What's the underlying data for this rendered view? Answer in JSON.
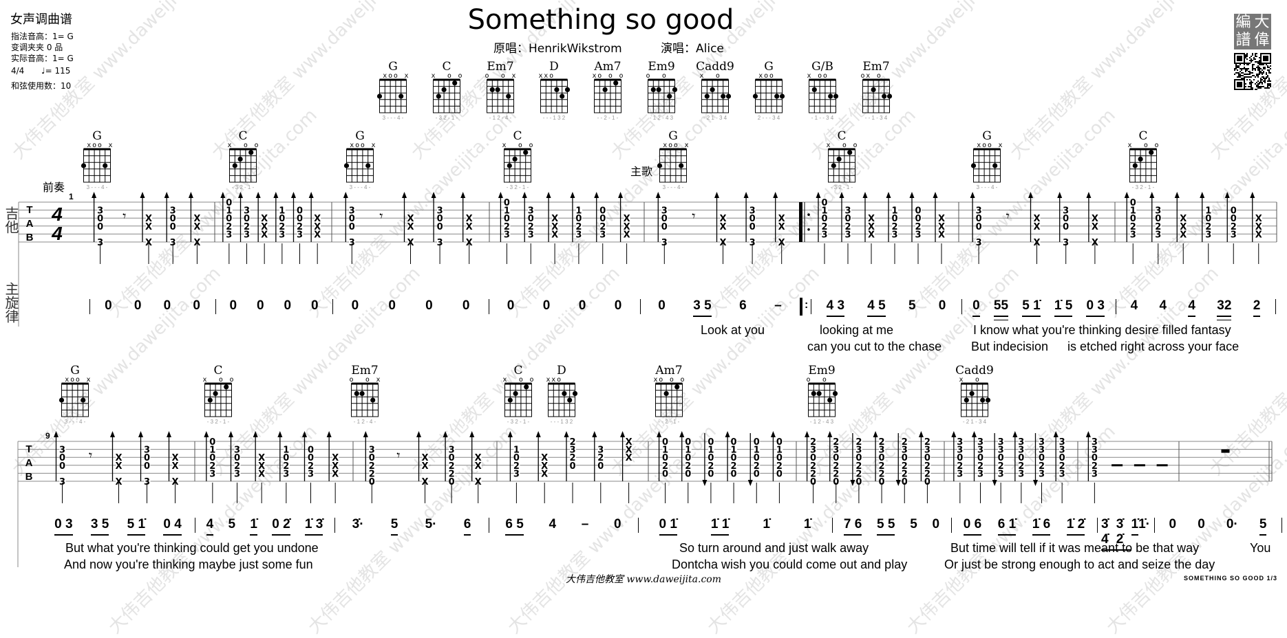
{
  "watermark": {
    "cn": "大伟吉他教室",
    "url": "www.daweijita.com"
  },
  "header": {
    "type": "女声调曲谱",
    "fingering_key": "指法音高：1= G",
    "capo": "变调夹夹  0 品",
    "actual_key": "实际音高：1= G",
    "time_signature": "4/4",
    "tempo": "♩= 115",
    "chord_count": "和弦使用数：10"
  },
  "title": "Something so good",
  "original_singer": "原唱：HenrikWikstrom",
  "performer": "演唱：Alice",
  "logo": [
    "編",
    "大",
    "譜",
    "偉"
  ],
  "chord_library": {
    "G": {
      "name": "G",
      "markers": " xoo x",
      "dots": [
        [
          6,
          3
        ],
        [
          2,
          3
        ]
      ],
      "fingering": "3 - - - 4 -"
    },
    "C": {
      "name": "C",
      "markers": "x  o o",
      "dots": [
        [
          5,
          3
        ],
        [
          4,
          2
        ],
        [
          2,
          1
        ]
      ],
      "fingering": "- 3 2 - 1 -"
    },
    "Em7": {
      "name": "Em7",
      "markers": "o  o x",
      "dots": [
        [
          5,
          2
        ],
        [
          4,
          2
        ],
        [
          2,
          3
        ]
      ],
      "fingering": "- 1 2 - 4 -"
    },
    "D": {
      "name": "D",
      "markers": "xxo   ",
      "dots": [
        [
          3,
          2
        ],
        [
          2,
          3
        ],
        [
          1,
          2
        ]
      ],
      "fingering": "- - - 1 3 2"
    },
    "Am7": {
      "name": "Am7",
      "markers": "xo o o",
      "dots": [
        [
          4,
          2
        ],
        [
          2,
          1
        ]
      ],
      "fingering": "- - 2 - 1 -"
    },
    "Em9": {
      "name": "Em9",
      "markers": "o  o  ",
      "dots": [
        [
          5,
          2
        ],
        [
          4,
          2
        ],
        [
          2,
          3
        ],
        [
          1,
          2
        ]
      ],
      "fingering": "- 1 2 - 4 3"
    },
    "Cadd9": {
      "name": "Cadd9",
      "markers": "x  o  ",
      "dots": [
        [
          5,
          3
        ],
        [
          4,
          2
        ],
        [
          2,
          3
        ],
        [
          1,
          3
        ]
      ],
      "fingering": "- 2 1 - 3 4"
    },
    "G2": {
      "name": "G",
      "markers": " xoo  ",
      "dots": [
        [
          6,
          3
        ],
        [
          2,
          3
        ],
        [
          1,
          3
        ]
      ],
      "fingering": "2 - - - 3 4"
    },
    "G/B": {
      "name": "G/B",
      "markers": "x oo  ",
      "dots": [
        [
          5,
          2
        ],
        [
          2,
          3
        ],
        [
          1,
          3
        ]
      ],
      "fingering": "- 1 - - 3 4"
    },
    "Em7b": {
      "name": "Em7",
      "markers": "ox o  ",
      "dots": [
        [
          4,
          2
        ],
        [
          2,
          3
        ],
        [
          1,
          3
        ]
      ],
      "fingering": "- - 1 - 3 4"
    }
  },
  "top_chords": [
    "G",
    "C",
    "Em7",
    "D",
    "Am7",
    "Em9",
    "Cadd9",
    "G2",
    "G/B",
    "Em7b"
  ],
  "systems": [
    {
      "instrument_label": "吉他",
      "melody_label": "主旋律",
      "measure_number": "1",
      "time_signature": [
        "4",
        "4"
      ],
      "sections": [
        {
          "label": "前奏"
        },
        {
          "label": "主歌"
        }
      ],
      "chords": [
        "G",
        "C",
        "G",
        "C",
        "G",
        "C",
        "G",
        "C"
      ],
      "measures": [
        {
          "repeat_start": false,
          "cols": [
            [
              "up",
              ",3,0,0,,3"
            ],
            [
              "rest"
            ],
            [
              "up",
              ",,X,X,,X"
            ],
            [
              "up",
              ",3,0,0,,3"
            ],
            [
              "up",
              ",,X,X,,X"
            ]
          ]
        },
        {
          "cols": [
            [
              "up",
              "0,1,0,2,3,"
            ],
            [
              "up",
              ",3,0,2,3,"
            ],
            [
              "up",
              ",,X,X,X,"
            ],
            [
              "up",
              ",1,0,2,3,"
            ],
            [
              "up",
              ",0,0,2,3,"
            ],
            [
              "up",
              ",,X,X,X,"
            ]
          ]
        },
        {
          "cols": [
            [
              "up",
              ",3,0,0,,3"
            ],
            [
              "rest"
            ],
            [
              "up",
              ",,X,X,,X"
            ],
            [
              "up",
              ",3,0,0,,3"
            ],
            [
              "up",
              ",,X,X,,X"
            ]
          ]
        },
        {
          "cols": [
            [
              "up",
              "0,1,0,2,3,"
            ],
            [
              "up",
              ",3,0,2,3,"
            ],
            [
              "up",
              ",,X,X,X,"
            ],
            [
              "up",
              ",1,0,2,3,"
            ],
            [
              "up",
              ",0,0,2,3,"
            ],
            [
              "up",
              ",,X,X,X,"
            ]
          ]
        },
        {
          "cols": [
            [
              "up",
              ",3,0,0,,3"
            ],
            [
              "rest"
            ],
            [
              "up",
              ",,X,X,,X"
            ],
            [
              "up",
              ",3,0,0,,3"
            ],
            [
              "up",
              ",,X,X,,X"
            ]
          ]
        },
        {
          "repeat_start": true,
          "cols": [
            [
              "up",
              "0,1,0,2,3,"
            ],
            [
              "up",
              ",3,0,2,3,"
            ],
            [
              "up",
              ",,X,X,X,"
            ],
            [
              "up",
              ",1,0,2,3,"
            ],
            [
              "up",
              ",0,0,2,3,"
            ],
            [
              "up",
              ",,X,X,X,"
            ]
          ]
        },
        {
          "cols": [
            [
              "up",
              ",3,0,0,,3"
            ],
            [
              "rest"
            ],
            [
              "up",
              ",,X,X,,X"
            ],
            [
              "up",
              ",3,0,0,,3"
            ],
            [
              "up",
              ",,X,X,,X"
            ]
          ]
        },
        {
          "cols": [
            [
              "up",
              "0,1,0,2,3,"
            ],
            [
              "up",
              ",3,0,2,3,"
            ],
            [
              "up",
              ",,X,X,X,"
            ],
            [
              "up",
              ",1,0,2,3,"
            ],
            [
              "up",
              ",0,0,2,3,"
            ],
            [
              "up",
              ",,X,X,X,"
            ]
          ]
        }
      ],
      "jianpu": [
        [
          {
            "n": "0"
          },
          {
            "n": "0"
          },
          {
            "n": "0"
          },
          {
            "n": "0"
          }
        ],
        [
          {
            "n": "0"
          },
          {
            "n": "0"
          },
          {
            "n": "0"
          },
          {
            "n": "0"
          }
        ],
        [
          {
            "n": "0"
          },
          {
            "n": "0"
          },
          {
            "n": "0"
          },
          {
            "n": "0"
          }
        ],
        [
          {
            "n": "0"
          },
          {
            "n": "0"
          },
          {
            "n": "0"
          },
          {
            "n": "0"
          }
        ],
        [
          {
            "n": "0"
          },
          {
            "n": "3 5",
            "u": 1
          },
          {
            "n": "6"
          },
          {
            "n": "–"
          }
        ],
        [
          {
            "n": "4 3",
            "u": 1
          },
          {
            "n": "4 5",
            "u": 1
          },
          {
            "n": "5"
          },
          {
            "n": "0"
          }
        ],
        [
          {
            "n": "0",
            "u": 1
          },
          {
            "n": "55",
            "u": 2
          },
          {
            "n": "5 1̇",
            "u": 1
          },
          {
            "n": "1̇ 5",
            "u": 1
          },
          {
            "n": "0 3",
            "u": 1
          }
        ],
        [
          {
            "n": "4"
          },
          {
            "n": "4"
          },
          {
            "n": "4",
            "u": 1
          },
          {
            "n": "32",
            "u": 2
          },
          {
            "n": "2",
            "u": 1
          }
        ]
      ],
      "lyrics": [
        {
          "text": "Look at you",
          "row": 0
        },
        {
          "text": "looking at me",
          "row": 0
        },
        {
          "text": "I know what you're thinking desire filled fantasy",
          "row": 0
        },
        {
          "text": "can you cut to the chase",
          "row": 1
        },
        {
          "text": "But indecision",
          "row": 1
        },
        {
          "text": "is etched right across your face",
          "row": 1
        }
      ]
    },
    {
      "measure_number": "9",
      "chords": [
        "G",
        "C",
        "Em7",
        "C",
        "D",
        "Am7",
        "Em9",
        "Cadd9"
      ],
      "measures": [
        {
          "cols": [
            [
              "up",
              ",3,0,0,,3"
            ],
            [
              "rest"
            ],
            [
              "up",
              ",,X,X,,X"
            ],
            [
              "up",
              ",3,0,0,,3"
            ],
            [
              "up",
              ",,X,X,,X"
            ]
          ]
        },
        {
          "cols": [
            [
              "up",
              "0,1,0,2,3,"
            ],
            [
              "up",
              ",3,0,2,3,"
            ],
            [
              "up",
              ",,X,X,X,"
            ],
            [
              "up",
              ",1,0,2,3,"
            ],
            [
              "up",
              ",0,0,2,3,"
            ],
            [
              "up",
              ",,X,X,X,"
            ]
          ]
        },
        {
          "cols": [
            [
              "up",
              ",3,0,2,2,0"
            ],
            [
              "rest"
            ],
            [
              "up",
              ",,X,X,,X"
            ],
            [
              "up",
              ",3,0,2,2,0"
            ],
            [
              "up",
              ",,X,X,,X"
            ]
          ]
        },
        {
          "cols": [
            [
              "up",
              ",1,0,2,3,"
            ],
            [
              "up",
              ",,X,X,X,"
            ],
            [
              "up",
              "2,3,2,0,,"
            ],
            [
              "up",
              ",3,2,0,,"
            ],
            [
              "up",
              "X,X,X,,,"
            ]
          ]
        },
        {
          "cols": [
            [
              "up",
              "0,1,0,2,0,"
            ],
            [
              "up",
              "0,1,0,2,0,"
            ],
            [
              "down",
              "0,1,0,2,0,"
            ],
            [
              "up",
              "0,1,0,2,0,"
            ],
            [
              "down",
              "0,1,0,2,0,"
            ],
            [
              "up",
              "0,1,0,2,0,"
            ]
          ]
        },
        {
          "cols": [
            [
              "up",
              "2,3,0,2,2,0"
            ],
            [
              "up",
              "2,3,0,2,2,0"
            ],
            [
              "down",
              "2,3,0,2,2,0"
            ],
            [
              "up",
              "2,3,0,2,2,0"
            ],
            [
              "down",
              "2,3,0,2,2,0"
            ],
            [
              "up",
              "2,3,0,2,2,0"
            ]
          ]
        },
        {
          "cols": [
            [
              "up",
              "3,3,0,2,3,"
            ],
            [
              "up",
              "3,3,0,2,3,"
            ],
            [
              "down",
              "3,3,0,2,3,"
            ],
            [
              "up",
              "3,3,0,2,3,"
            ],
            [
              "down",
              "3,3,0,2,3,"
            ],
            [
              "up",
              "3,3,0,2,3,"
            ]
          ]
        },
        {
          "cols": [
            [
              "up",
              "3,3,0,2,3,"
            ],
            [
              "dash"
            ],
            [
              "dash"
            ],
            [
              "dash"
            ]
          ]
        },
        {
          "cols": [
            [
              "wholerest"
            ]
          ]
        }
      ],
      "jianpu": [
        [
          {
            "n": "0 3",
            "u": 1
          },
          {
            "n": "3 5",
            "u": 1
          },
          {
            "n": "5 1̇",
            "u": 1
          },
          {
            "n": "0 4",
            "u": 1
          }
        ],
        [
          {
            "n": "4",
            "u": 1
          },
          {
            "n": "5"
          },
          {
            "n": "1̇",
            "u": 1
          },
          {
            "n": "0 2̇",
            "u": 1
          },
          {
            "n": "1̇ 3̇",
            "u": 1
          }
        ],
        [
          {
            "n": "3̇·"
          },
          {
            "n": "5",
            "u": 1
          },
          {
            "n": "5·"
          },
          {
            "n": "6",
            "u": 1
          }
        ],
        [
          {
            "n": "6 5",
            "u": 1
          },
          {
            "n": "4"
          },
          {
            "n": "–"
          },
          {
            "n": "0"
          }
        ],
        [
          {
            "n": "0 1̇",
            "u": 1
          },
          {
            "n": "1̇ 1̇",
            "u": 1
          },
          {
            "n": "1̇"
          },
          {
            "n": "1̇"
          }
        ],
        [
          {
            "n": "7 6",
            "u": 1
          },
          {
            "n": "5 5",
            "u": 1
          },
          {
            "n": "5"
          },
          {
            "n": "0"
          }
        ],
        [
          {
            "n": "0 6",
            "u": 1
          },
          {
            "n": "6 1̇",
            "u": 1
          },
          {
            "n": "1̇ 6",
            "u": 1
          },
          {
            "n": "1̇ 2̇",
            "u": 1
          }
        ],
        [
          {
            "n": "3̇ 4̇",
            "u": 1
          },
          {
            "n": "3̇ 2̇",
            "u": 1
          },
          {
            "n": "1̇",
            "u": 1
          },
          {
            "n": "1̇·"
          }
        ],
        [
          {
            "n": "0"
          },
          {
            "n": "0"
          },
          {
            "n": "0·"
          },
          {
            "n": "5",
            "u": 1
          }
        ]
      ],
      "lyrics": [
        {
          "text": "But what you're thinking could get you undone",
          "row": 0
        },
        {
          "text": "And now you're thinking maybe just some fun",
          "row": 1
        },
        {
          "text": "So turn around and just walk away",
          "row": 0
        },
        {
          "text": "Dontcha wish you could come out and play",
          "row": 1
        },
        {
          "text": "But time will tell if it was meant to be that way",
          "row": 0
        },
        {
          "text": "You",
          "row": 0
        },
        {
          "text": "Or just be strong enough to act and seize the day",
          "row": 1
        }
      ]
    }
  ],
  "footer": "大伟吉他教室  www.daweijita.com",
  "page_info": "SOMETHING SO GOOD   1/3"
}
